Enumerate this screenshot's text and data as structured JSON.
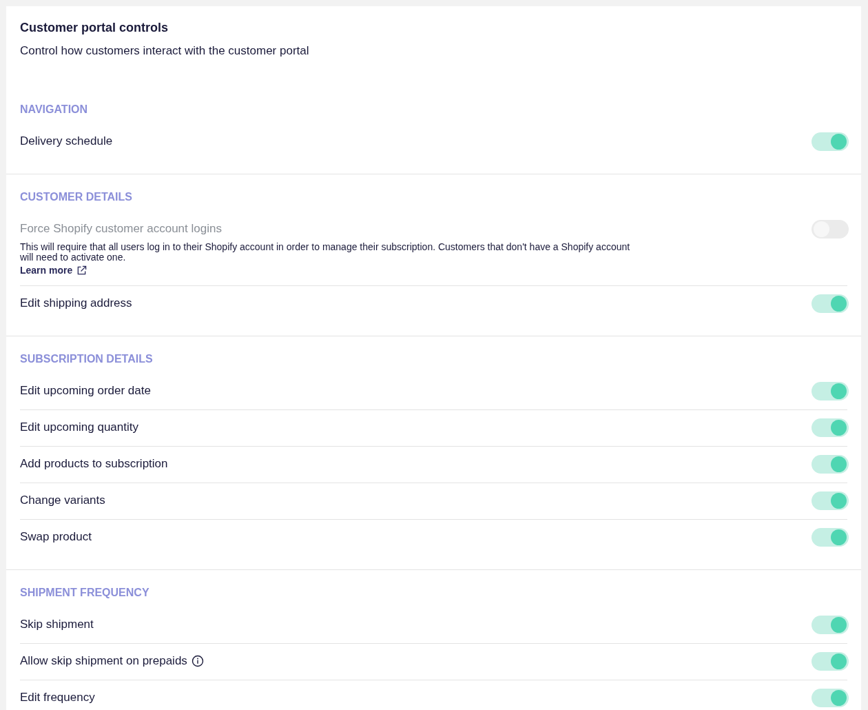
{
  "header": {
    "title": "Customer portal controls",
    "subtitle": "Control how customers interact with the customer portal"
  },
  "sections": [
    {
      "label": "NAVIGATION",
      "rows": [
        {
          "label": "Delivery schedule",
          "on": true,
          "disabled": false
        }
      ]
    },
    {
      "label": "CUSTOMER DETAILS",
      "rows": [
        {
          "label": "Force Shopify customer account logins",
          "on": false,
          "disabled": true,
          "description": "This will require that all users log in to their Shopify account in order to manage their subscription. Customers that don't have a Shopify account will need to activate one.",
          "link": "Learn more"
        },
        {
          "label": "Edit shipping address",
          "on": true,
          "disabled": false
        }
      ]
    },
    {
      "label": "SUBSCRIPTION DETAILS",
      "rows": [
        {
          "label": "Edit upcoming order date",
          "on": true,
          "disabled": false
        },
        {
          "label": "Edit upcoming quantity",
          "on": true,
          "disabled": false
        },
        {
          "label": "Add products to subscription",
          "on": true,
          "disabled": false
        },
        {
          "label": "Change variants",
          "on": true,
          "disabled": false
        },
        {
          "label": "Swap product",
          "on": true,
          "disabled": false
        }
      ]
    },
    {
      "label": "SHIPMENT FREQUENCY",
      "rows": [
        {
          "label": "Skip shipment",
          "on": true,
          "disabled": false
        },
        {
          "label": "Allow skip shipment on prepaids",
          "on": true,
          "disabled": false,
          "info": true
        },
        {
          "label": "Edit frequency",
          "on": true,
          "disabled": false
        }
      ]
    }
  ]
}
